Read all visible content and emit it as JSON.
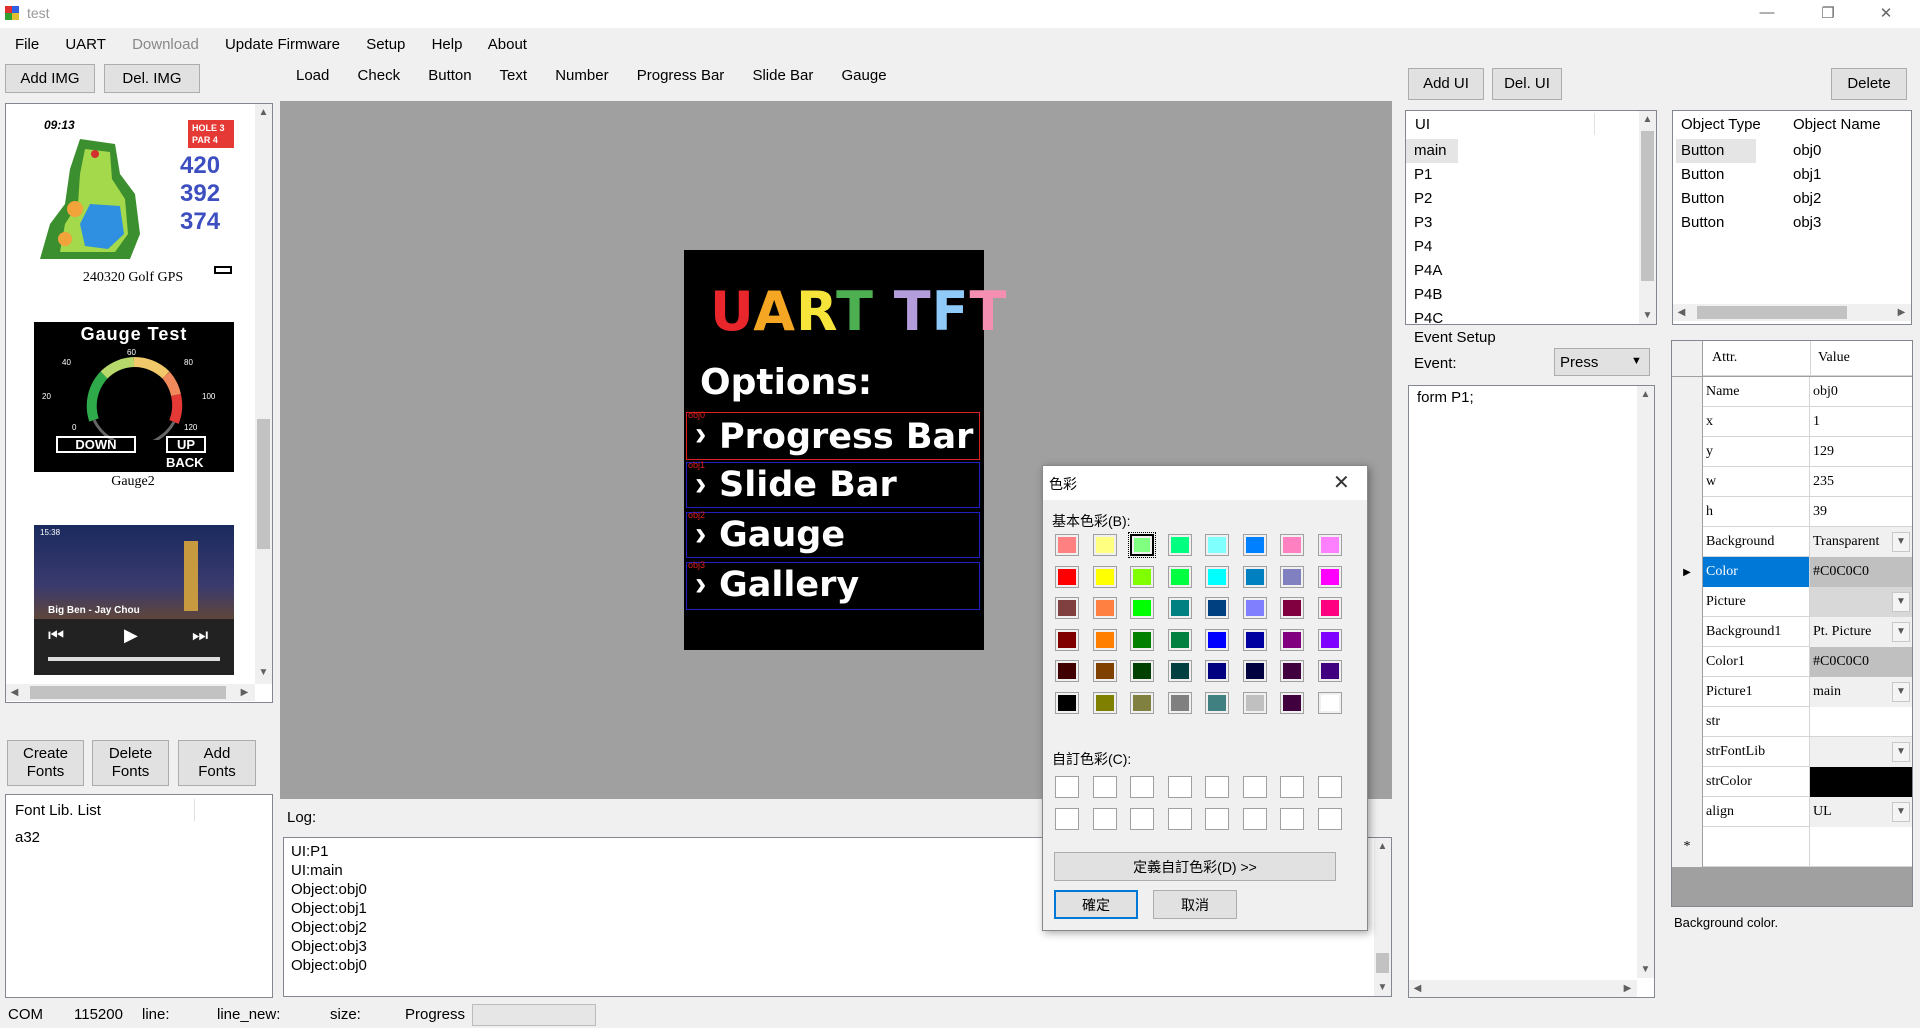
{
  "window": {
    "title": "test",
    "min": "—",
    "max": "❐",
    "close": "✕"
  },
  "menu": [
    "File",
    "UART",
    "Download",
    "Update Firmware",
    "Setup",
    "Help",
    "About"
  ],
  "left_buttons": {
    "add_img": "Add IMG",
    "del_img": "Del. IMG"
  },
  "tabs": [
    "Load",
    "Check",
    "Button",
    "Text",
    "Number",
    "Progress Bar",
    "Slide Bar",
    "Gauge"
  ],
  "images": [
    {
      "caption": "240320 Golf GPS",
      "time": "09:13",
      "hole": "HOLE 3",
      "par": "PAR 4",
      "d1": "420",
      "d2": "392",
      "d3": "374"
    },
    {
      "caption": "Gauge2",
      "title": "Gauge Test",
      "down": "DOWN",
      "up": "UP",
      "back": "BACK",
      "t40": "40",
      "t60": "60",
      "t80": "80",
      "t20": "20",
      "t100": "100",
      "t0": "0",
      "t120": "120"
    },
    {
      "caption": "",
      "time": "15:38",
      "song": "Big Ben - Jay Chou"
    }
  ],
  "font_buttons": {
    "create": "Create Fonts",
    "delete": "Delete Fonts",
    "add": "Add Fonts"
  },
  "font_list": {
    "header": "Font Lib. List",
    "items": [
      "a32"
    ]
  },
  "preview": {
    "title_letters": [
      "U",
      "A",
      "R",
      "T",
      " ",
      "T",
      "F",
      "T"
    ],
    "title_colors": [
      "#e8262b",
      "#f5a623",
      "#f7e43a",
      "#4caf50",
      "#000000",
      "#b39ddb",
      "#90caf9",
      "#f48fb1"
    ],
    "options": "Options:",
    "items": [
      {
        "tag": "obj0",
        "label": "Progress Bar",
        "border": "#e02020"
      },
      {
        "tag": "obj1",
        "label": "Slide Bar",
        "border": "#2020c0"
      },
      {
        "tag": "obj2",
        "label": "Gauge",
        "border": "#2020c0"
      },
      {
        "tag": "obj3",
        "label": "Gallery",
        "border": "#2020c0"
      }
    ]
  },
  "log": {
    "label": "Log:",
    "lines": [
      "UI:P1",
      "UI:main",
      "Object:obj0",
      "Object:obj1",
      "Object:obj2",
      "Object:obj3",
      "Object:obj0"
    ]
  },
  "ui_buttons": {
    "add_ui": "Add UI",
    "del_ui": "Del. UI",
    "delete": "Delete"
  },
  "ui_list": {
    "header": "UI",
    "items": [
      "main",
      "P1",
      "P2",
      "P3",
      "P4",
      "P4A",
      "P4B",
      "P4C"
    ]
  },
  "objects": {
    "col_type": "Object Type",
    "col_name": "Object Name",
    "rows": [
      {
        "type": "Button",
        "name": "obj0"
      },
      {
        "type": "Button",
        "name": "obj1"
      },
      {
        "type": "Button",
        "name": "obj2"
      },
      {
        "type": "Button",
        "name": "obj3"
      }
    ]
  },
  "event": {
    "group": "Event Setup",
    "label": "Event:",
    "selected": "Press",
    "code": "form P1;"
  },
  "props": {
    "col_attr": "Attr.",
    "col_value": "Value",
    "rows": [
      {
        "k": "Name",
        "v": "obj0"
      },
      {
        "k": "x",
        "v": "1"
      },
      {
        "k": "y",
        "v": "129"
      },
      {
        "k": "w",
        "v": "235"
      },
      {
        "k": "h",
        "v": "39"
      },
      {
        "k": "Background",
        "v": "Transparent",
        "dd": true
      },
      {
        "k": "Color",
        "v": "#C0C0C0",
        "selected": true
      },
      {
        "k": "Picture",
        "v": "",
        "dd": true,
        "grey": true
      },
      {
        "k": "Background1",
        "v": "Pt. Picture",
        "dd": true
      },
      {
        "k": "Color1",
        "v": "#C0C0C0",
        "grey": true
      },
      {
        "k": "Picture1",
        "v": "main",
        "dd": true
      },
      {
        "k": "str",
        "v": ""
      },
      {
        "k": "strFontLib",
        "v": "",
        "dd": true
      },
      {
        "k": "strColor",
        "v": "",
        "black": true
      },
      {
        "k": "align",
        "v": "UL",
        "dd": true
      }
    ],
    "new_row_marker": "*",
    "description": "Background color."
  },
  "color_dialog": {
    "title": "色彩",
    "basic_label": "基本色彩(B):",
    "custom_label": "自訂色彩(C):",
    "define_button": "定義自訂色彩(D) >>",
    "ok": "確定",
    "cancel": "取消",
    "basic_colors": [
      "#ff8080",
      "#ffff80",
      "#80ff80",
      "#00ff80",
      "#80ffff",
      "#0080ff",
      "#ff80c0",
      "#ff80ff",
      "#ff0000",
      "#ffff00",
      "#80ff00",
      "#00ff40",
      "#00ffff",
      "#0080c0",
      "#8080c0",
      "#ff00ff",
      "#804040",
      "#ff8040",
      "#00ff00",
      "#008080",
      "#004080",
      "#8080ff",
      "#800040",
      "#ff0080",
      "#800000",
      "#ff8000",
      "#008000",
      "#008040",
      "#0000ff",
      "#0000a0",
      "#800080",
      "#8000ff",
      "#400000",
      "#804000",
      "#004000",
      "#004040",
      "#000080",
      "#000040",
      "#400040",
      "#400080",
      "#000000",
      "#808000",
      "#808040",
      "#808080",
      "#408080",
      "#c0c0c0",
      "#400040",
      "#ffffff"
    ],
    "selected_index": 2
  },
  "status": {
    "com": "COM",
    "baud": "115200",
    "line": "line:",
    "line_new": "line_new:",
    "size": "size:",
    "progress": "Progress"
  }
}
